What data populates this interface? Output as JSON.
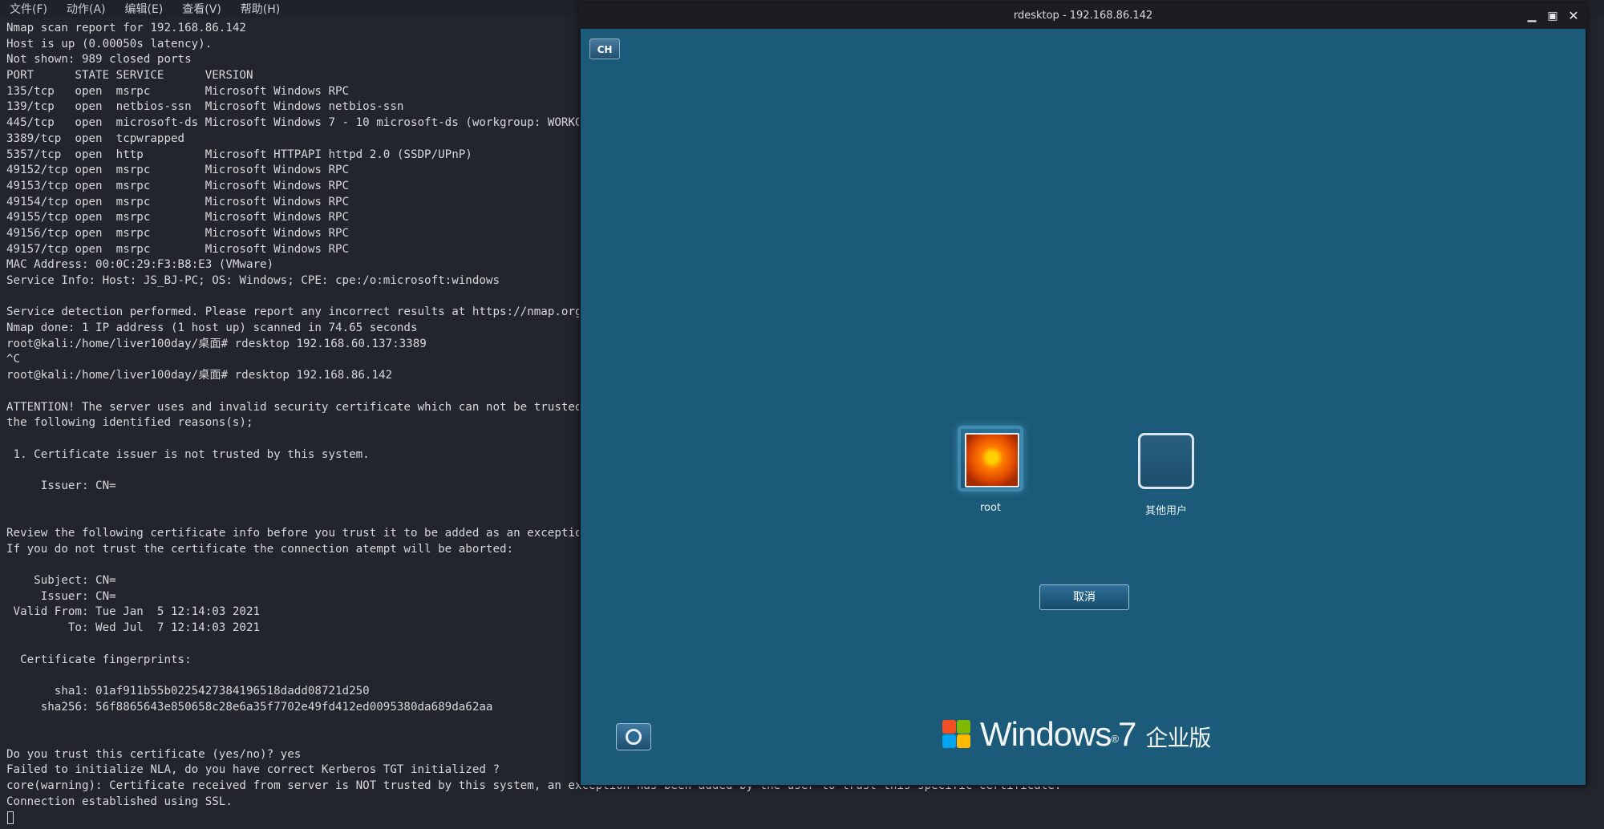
{
  "menubar": {
    "items": [
      "文件(F)",
      "动作(A)",
      "编辑(E)",
      "查看(V)",
      "帮助(H)"
    ]
  },
  "terminal": {
    "lines": [
      "Nmap scan report for 192.168.86.142",
      "Host is up (0.00050s latency).",
      "Not shown: 989 closed ports",
      "PORT      STATE SERVICE      VERSION",
      "135/tcp   open  msrpc        Microsoft Windows RPC",
      "139/tcp   open  netbios-ssn  Microsoft Windows netbios-ssn",
      "445/tcp   open  microsoft-ds Microsoft Windows 7 - 10 microsoft-ds (workgroup: WORKGROUP)",
      "3389/tcp  open  tcpwrapped",
      "5357/tcp  open  http         Microsoft HTTPAPI httpd 2.0 (SSDP/UPnP)",
      "49152/tcp open  msrpc        Microsoft Windows RPC",
      "49153/tcp open  msrpc        Microsoft Windows RPC",
      "49154/tcp open  msrpc        Microsoft Windows RPC",
      "49155/tcp open  msrpc        Microsoft Windows RPC",
      "49156/tcp open  msrpc        Microsoft Windows RPC",
      "49157/tcp open  msrpc        Microsoft Windows RPC",
      "MAC Address: 00:0C:29:F3:B8:E3 (VMware)",
      "Service Info: Host: JS_BJ-PC; OS: Windows; CPE: cpe:/o:microsoft:windows",
      "",
      "Service detection performed. Please report any incorrect results at https://nmap.org/submit/ .",
      "Nmap done: 1 IP address (1 host up) scanned in 74.65 seconds",
      "root@kali:/home/liver100day/桌面# rdesktop 192.168.60.137:3389",
      "^C",
      "root@kali:/home/liver100day/桌面# rdesktop 192.168.86.142",
      "",
      "ATTENTION! The server uses and invalid security certificate which can not be trusted for",
      "the following identified reasons(s);",
      "",
      " 1. Certificate issuer is not trusted by this system.",
      "",
      "     Issuer: CN=",
      "",
      "",
      "Review the following certificate info before you trust it to be added as an exception.",
      "If you do not trust the certificate the connection atempt will be aborted:",
      "",
      "    Subject: CN=",
      "     Issuer: CN=",
      " Valid From: Tue Jan  5 12:14:03 2021",
      "         To: Wed Jul  7 12:14:03 2021",
      "",
      "  Certificate fingerprints:",
      "",
      "       sha1: 01af911b55b0225427384196518dadd08721d250",
      "     sha256: 56f8865643e850658c28e6a35f7702e49fd412ed0095380da689da62aa",
      "",
      "",
      "Do you trust this certificate (yes/no)? yes",
      "Failed to initialize NLA, do you have correct Kerberos TGT initialized ?",
      "core(warning): Certificate received from server is NOT trusted by this system, an exception has been added by the user to trust this specific certificate.",
      "Connection established using SSL."
    ]
  },
  "rdesktop": {
    "title": "rdesktop - 192.168.86.142",
    "minimize_glyph": "▁",
    "maximize_glyph": "▣",
    "close_glyph": "✕",
    "lang_button": "CH",
    "users": [
      {
        "label": "root"
      },
      {
        "label": "其他用户"
      }
    ],
    "cancel_label": "取消",
    "brand": {
      "name": "Windows",
      "sup": "®",
      "version": "7",
      "edition": "企业版"
    },
    "colors": {
      "screen_bg": "#1b5a78"
    }
  }
}
